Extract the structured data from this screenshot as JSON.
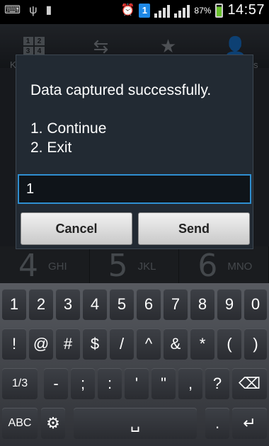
{
  "status_bar": {
    "signal_icon_1": "signal-bars",
    "battery_percent": "87%",
    "time": "14:57",
    "badge": "1"
  },
  "tabs": [
    {
      "icon": "keypad-icon",
      "label": "K"
    },
    {
      "icon": "call-log-icon",
      "label": ""
    },
    {
      "icon": "star-icon",
      "label": ""
    },
    {
      "icon": "contacts-icon",
      "label": "s"
    }
  ],
  "keypad_grid": [
    "1",
    "2",
    "3",
    "4"
  ],
  "dialer_row": [
    {
      "digit": "4",
      "letters": "GHI"
    },
    {
      "digit": "5",
      "letters": "JKL"
    },
    {
      "digit": "6",
      "letters": "MNO"
    }
  ],
  "dialog": {
    "message": "Data captured successfully.\n\n1. Continue\n2. Exit",
    "input_value": "1",
    "cancel_label": "Cancel",
    "send_label": "Send"
  },
  "keyboard": {
    "row1": [
      "1",
      "2",
      "3",
      "4",
      "5",
      "6",
      "7",
      "8",
      "9",
      "0"
    ],
    "row2": [
      "!",
      "@",
      "#",
      "$",
      "/",
      "^",
      "&",
      "*",
      "(",
      ")"
    ],
    "row3": [
      "1/3",
      "-",
      ";",
      ":",
      "'",
      "\"",
      ",",
      "?",
      "⌫"
    ],
    "row4": [
      "ABC",
      "⚙",
      "␣",
      ".",
      "↵"
    ]
  }
}
